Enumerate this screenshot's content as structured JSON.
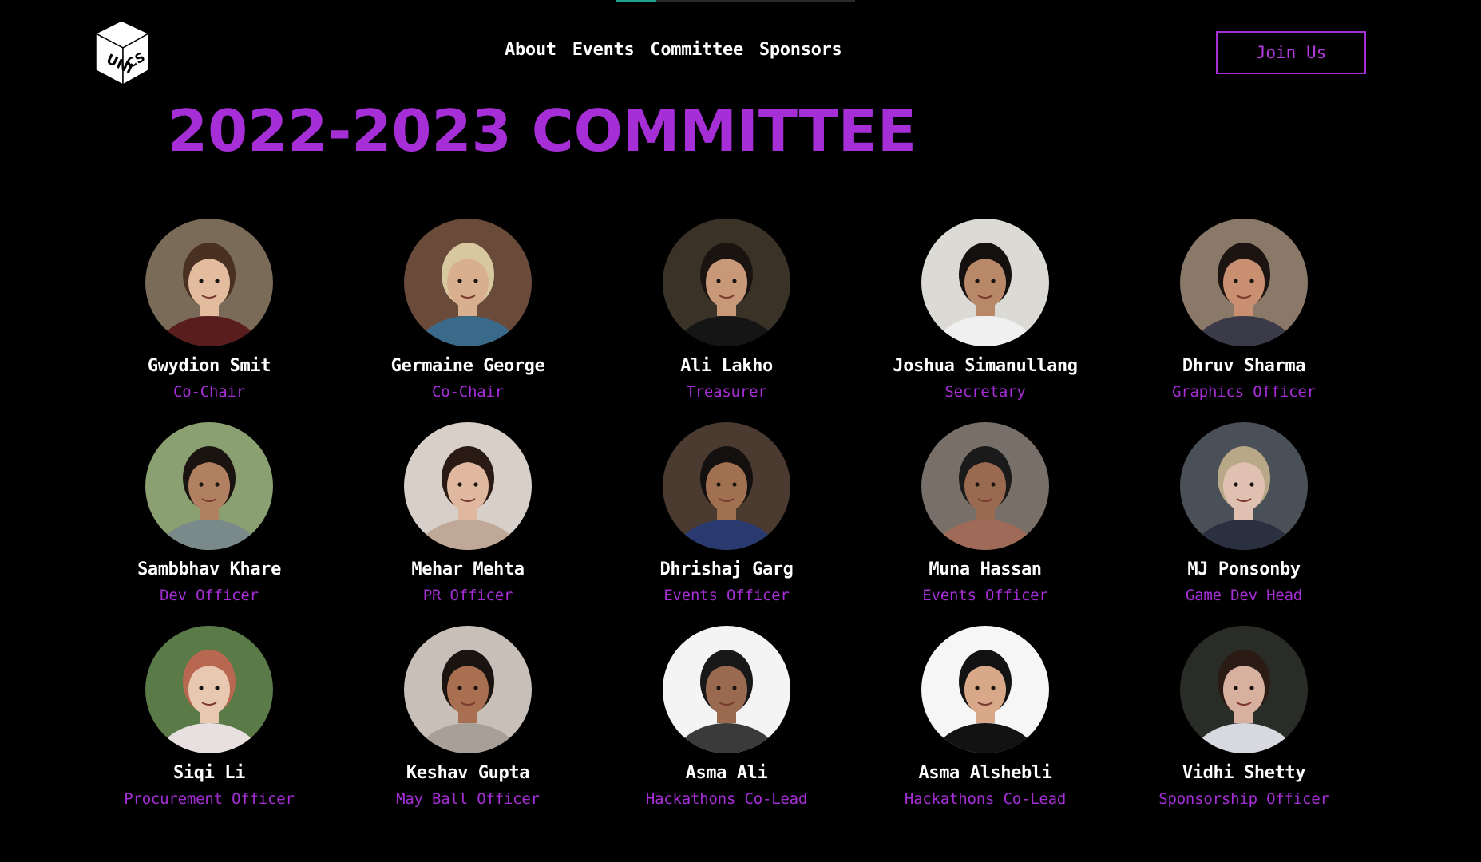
{
  "header": {
    "logo_icon": "unics-cube-logo",
    "nav": [
      "About",
      "Events",
      "Committee",
      "Sponsors"
    ],
    "join_label": "Join Us"
  },
  "page": {
    "title": "2022-2023 COMMITTEE"
  },
  "colors": {
    "background": "#000000",
    "accent": "#a62ed6",
    "text": "#ffffff"
  },
  "members": [
    {
      "name": "Gwydion Smit",
      "role": "Co-Chair",
      "photo_bg": "#7a6a58",
      "skin": "#e3bca0",
      "hair": "#4a3020",
      "top": "#5a1d1d"
    },
    {
      "name": "Germaine George",
      "role": "Co-Chair",
      "photo_bg": "#6a4b3a",
      "skin": "#d8b090",
      "hair": "#d8c8a0",
      "top": "#3a6a8a"
    },
    {
      "name": "Ali Lakho",
      "role": "Treasurer",
      "photo_bg": "#3a3226",
      "skin": "#c89878",
      "hair": "#1a1410",
      "top": "#151515"
    },
    {
      "name": "Joshua Simanullang",
      "role": "Secretary",
      "photo_bg": "#dcdad4",
      "skin": "#b88868",
      "hair": "#151010",
      "top": "#f0f0f0"
    },
    {
      "name": "Dhruv Sharma",
      "role": "Graphics Officer",
      "photo_bg": "#8a7868",
      "skin": "#c89070",
      "hair": "#1c1410",
      "top": "#3a3a48"
    },
    {
      "name": "Sambbhav Khare",
      "role": "Dev Officer",
      "photo_bg": "#8aa070",
      "skin": "#b08060",
      "hair": "#1a1410",
      "top": "#7a8a8a"
    },
    {
      "name": "Mehar Mehta",
      "role": "PR Officer",
      "photo_bg": "#d8d0c8",
      "skin": "#e0b8a0",
      "hair": "#2a1a14",
      "top": "#c0a898"
    },
    {
      "name": "Dhrishaj Garg",
      "role": "Events Officer",
      "photo_bg": "#4a3a30",
      "skin": "#a07050",
      "hair": "#141010",
      "top": "#2a3a70"
    },
    {
      "name": "Muna Hassan",
      "role": "Events Officer",
      "photo_bg": "#787068",
      "skin": "#9a6a50",
      "hair": "#1a1a1a",
      "top": "#a06a58"
    },
    {
      "name": "MJ Ponsonby",
      "role": "Game Dev Head",
      "photo_bg": "#4a5058",
      "skin": "#e0c0b0",
      "hair": "#b8a888",
      "top": "#2a3040"
    },
    {
      "name": "Siqi Li",
      "role": "Procurement Officer",
      "photo_bg": "#5a7a48",
      "skin": "#e8c8b0",
      "hair": "#b86850",
      "top": "#e8e0e0"
    },
    {
      "name": "Keshav Gupta",
      "role": "May Ball Officer",
      "photo_bg": "#c8c0b8",
      "skin": "#a87050",
      "hair": "#1a1410",
      "top": "#a8a098"
    },
    {
      "name": "Asma Ali",
      "role": "Hackathons Co-Lead",
      "photo_bg": "#f4f4f4",
      "skin": "#9a6a50",
      "hair": "#181818",
      "top": "#3a3a3a"
    },
    {
      "name": "Asma Alshebli",
      "role": "Hackathons Co-Lead",
      "photo_bg": "#f6f6f6",
      "skin": "#d8a888",
      "hair": "#121212",
      "top": "#121212"
    },
    {
      "name": "Vidhi Shetty",
      "role": "Sponsorship Officer",
      "photo_bg": "#2a2c28",
      "skin": "#d8b0a0",
      "hair": "#2a1c14",
      "top": "#d8d8e0"
    }
  ]
}
